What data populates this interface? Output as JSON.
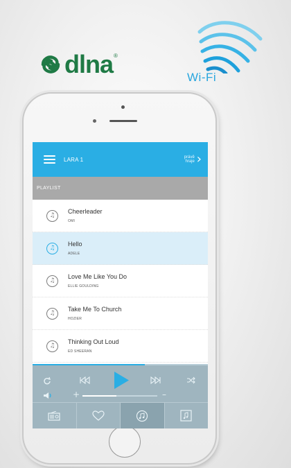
{
  "branding": {
    "dlna_text": "dlna",
    "dlna_tm": "®",
    "wifi_label": "Wi-Fi",
    "dlna_color": "#1f7a45",
    "wifi_color": "#29a6de"
  },
  "appbar": {
    "device_name": "LARA 1",
    "now_playing_label": "právě hraje",
    "menu_icon": "hamburger-menu-icon",
    "chevron_icon": "chevron-right-icon",
    "color": "#2aaee4"
  },
  "playlist": {
    "header": "PLAYLIST",
    "songs": [
      {
        "title": "Cheerleader",
        "artist": "OMI",
        "active": false
      },
      {
        "title": "Hello",
        "artist": "ADELE",
        "active": true
      },
      {
        "title": "Love Me Like You Do",
        "artist": "ELLIE GOULDING",
        "active": false
      },
      {
        "title": "Take Me To Church",
        "artist": "HOZIER",
        "active": false
      },
      {
        "title": "Thinking Out Loud",
        "artist": "ED SHEERAN",
        "active": false
      }
    ]
  },
  "player": {
    "progress": 0.64,
    "volume": 0.45,
    "icons": [
      "repeat-icon",
      "previous-icon",
      "play-icon",
      "next-icon",
      "shuffle-icon",
      "volume-icon"
    ],
    "volume_plus": "+",
    "volume_minus": "–"
  },
  "tabs": [
    {
      "icon": "radio-icon",
      "active": false
    },
    {
      "icon": "heart-icon",
      "active": false
    },
    {
      "icon": "music-disc-icon",
      "active": true
    },
    {
      "icon": "music-library-icon",
      "active": false
    }
  ]
}
